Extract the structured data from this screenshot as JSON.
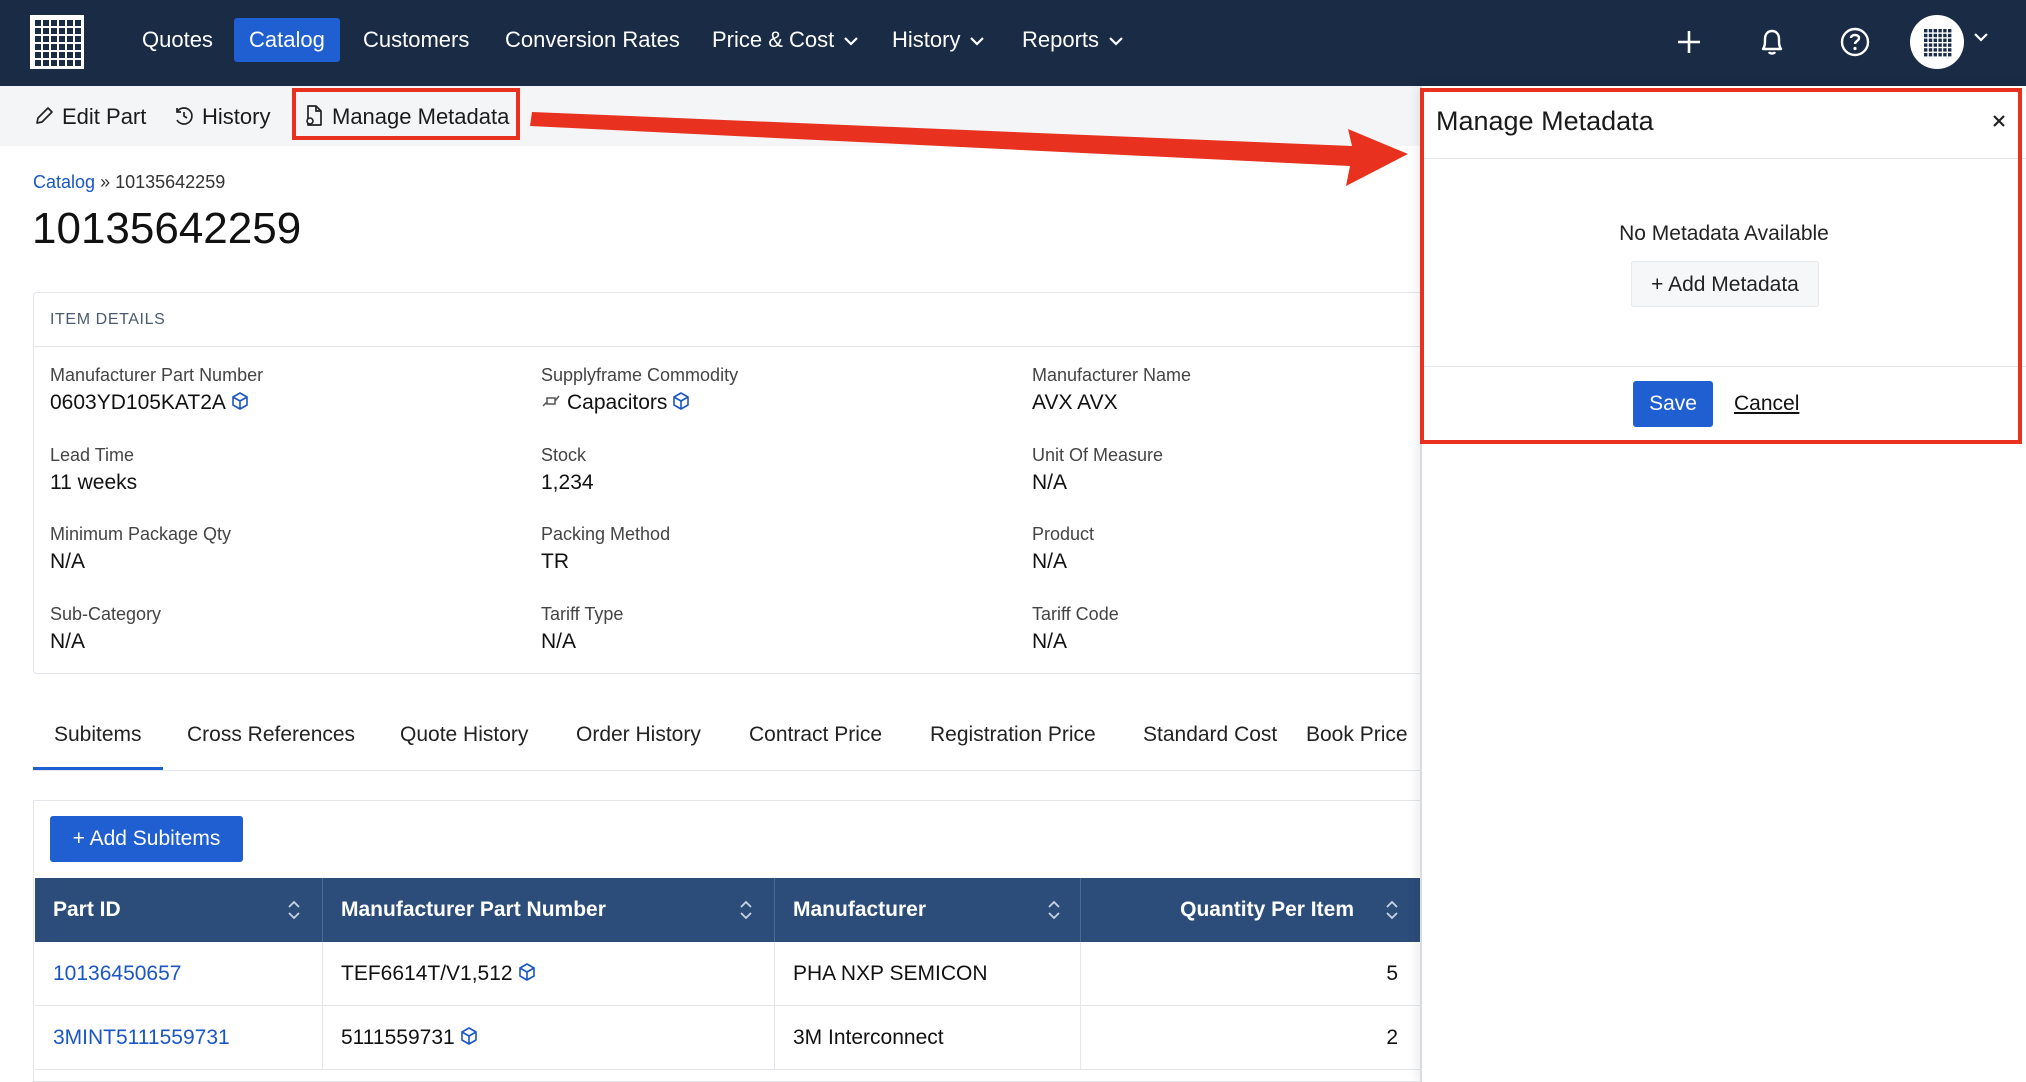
{
  "nav": {
    "items": [
      {
        "label": "Quotes",
        "active": false
      },
      {
        "label": "Catalog",
        "active": true
      },
      {
        "label": "Customers",
        "active": false
      },
      {
        "label": "Conversion Rates",
        "active": false
      },
      {
        "label": "Price & Cost",
        "active": false,
        "dropdown": true
      },
      {
        "label": "History",
        "active": false,
        "dropdown": true
      },
      {
        "label": "Reports",
        "active": false,
        "dropdown": true
      }
    ],
    "icons": [
      "plus-icon",
      "bell-icon",
      "help-icon",
      "avatar"
    ]
  },
  "toolbar": {
    "edit_part": "Edit Part",
    "history": "History",
    "manage_metadata": "Manage Metadata"
  },
  "breadcrumb": {
    "catalog": "Catalog",
    "separator": "»",
    "current": "10135642259"
  },
  "page_title": "10135642259",
  "item_details": {
    "heading": "ITEM DETAILS",
    "fields": [
      {
        "label": "Manufacturer Part Number",
        "value": "0603YD105KAT2A",
        "icon": "cube-icon"
      },
      {
        "label": "Supplyframe Commodity",
        "value": "Capacitors",
        "icon": "cube-icon",
        "prefix_icon": "capacitor-icon"
      },
      {
        "label": "Manufacturer Name",
        "value": "AVX AVX"
      },
      {
        "label": "Lead Time",
        "value": "11 weeks"
      },
      {
        "label": "Stock",
        "value": "1,234"
      },
      {
        "label": "Unit Of Measure",
        "value": "N/A"
      },
      {
        "label": "Minimum Package Qty",
        "value": "N/A"
      },
      {
        "label": "Packing Method",
        "value": "TR"
      },
      {
        "label": "Product",
        "value": "N/A"
      },
      {
        "label": "Sub-Category",
        "value": "N/A"
      },
      {
        "label": "Tariff Type",
        "value": "N/A"
      },
      {
        "label": "Tariff Code",
        "value": "N/A"
      }
    ]
  },
  "tabs": [
    {
      "label": "Subitems",
      "active": true
    },
    {
      "label": "Cross References"
    },
    {
      "label": "Quote History"
    },
    {
      "label": "Order History"
    },
    {
      "label": "Contract Price"
    },
    {
      "label": "Registration Price"
    },
    {
      "label": "Standard Cost"
    },
    {
      "label": "Book Price"
    }
  ],
  "subitems": {
    "add_button": "+ Add Subitems",
    "columns": [
      "Part ID",
      "Manufacturer Part Number",
      "Manufacturer",
      "Quantity Per Item"
    ],
    "rows": [
      {
        "part_id": "10136450657",
        "mpn": "TEF6614T/V1,512",
        "manufacturer": "PHA NXP SEMICON",
        "qty": "5"
      },
      {
        "part_id": "3MINT5111559731",
        "mpn": "5111559731",
        "manufacturer": "3M Interconnect",
        "qty": "2"
      }
    ]
  },
  "drawer": {
    "title": "Manage Metadata",
    "empty_message": "No Metadata Available",
    "add_label": "+ Add Metadata",
    "save_label": "Save",
    "cancel_label": "Cancel"
  },
  "colors": {
    "nav_bg": "#1a2b45",
    "accent": "#1f5fd1",
    "table_header": "#2c4d7a",
    "annotation_red": "#e8321f",
    "link": "#1a56c4"
  }
}
